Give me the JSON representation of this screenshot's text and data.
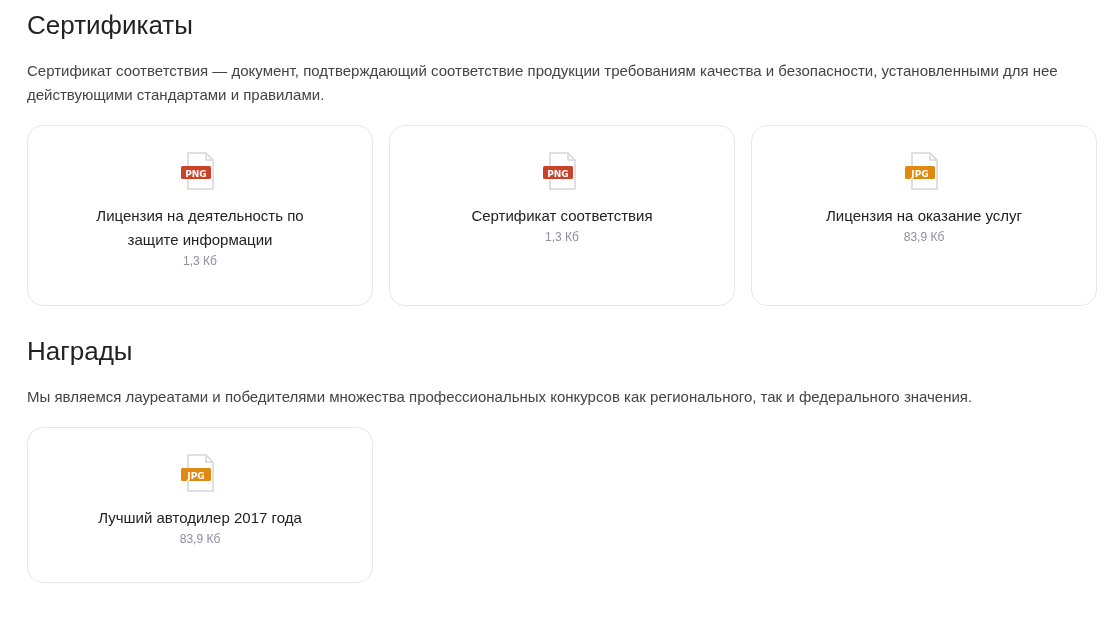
{
  "sections": [
    {
      "title": "Сертификаты",
      "description": "Сертификат соответствия — документ, подтверждающий соответствие продукции требованиям качества и безопасности, установленными для нее действующими стандартами и правилами.",
      "files": [
        {
          "format": "PNG",
          "color": "#c9432b",
          "name": "Лицензия на деятельность по защите информации",
          "size": "1,3 Кб"
        },
        {
          "format": "PNG",
          "color": "#c9432b",
          "name": "Сертификат соответствия",
          "size": "1,3 Кб"
        },
        {
          "format": "JPG",
          "color": "#e08a12",
          "name": "Лицензия на оказание услуг",
          "size": "83,9 Кб"
        }
      ]
    },
    {
      "title": "Награды",
      "description": "Мы являемся лауреатами и победителями множества профессиональных конкурсов как регионального, так и федерального значения.",
      "files": [
        {
          "format": "JPG",
          "color": "#e08a12",
          "name": "Лучший автодилер 2017 года",
          "size": "83,9 Кб"
        }
      ]
    }
  ]
}
